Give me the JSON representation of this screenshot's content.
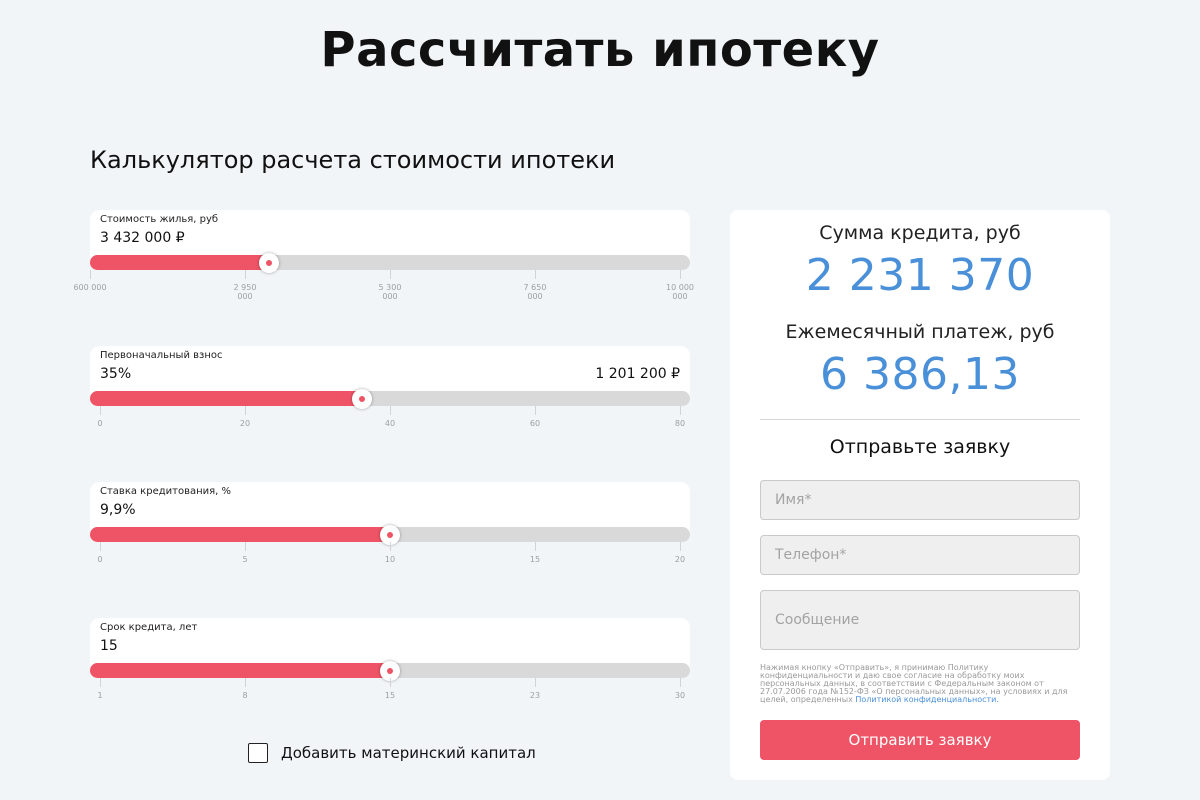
{
  "page_title": "Рассчитать ипотеку",
  "calculator_title": "Калькулятор расчета стоимости ипотеки",
  "sliders": [
    {
      "label": "Стоимость жилья, руб",
      "value": "3 432 000 ₽",
      "value_right": "",
      "level": 0.2975,
      "ticks": [
        "600 000",
        "2 950 000",
        "5 300 000",
        "7 650 000",
        "10 000 000"
      ]
    },
    {
      "label": "Первоначальный взнос",
      "value": "35%",
      "value_right": "1 201 200 ₽",
      "level": 0.4533,
      "ticks": [
        "0",
        "20",
        "40",
        "60",
        "80"
      ]
    },
    {
      "label": "Ставка кредитования, %",
      "value": "9,9%",
      "value_right": "",
      "level": 0.5,
      "ticks": [
        "0",
        "5",
        "10",
        "15",
        "20"
      ]
    },
    {
      "label": "Срок кредита, лет",
      "value": "15",
      "value_right": "",
      "level": 0.5,
      "ticks": [
        "1",
        "8",
        "15",
        "23",
        "30"
      ]
    }
  ],
  "maternal_capital": {
    "label": "Добавить материнский капитал",
    "checked": false
  },
  "result": {
    "loan_caption": "Сумма кредита, руб",
    "loan_value": "2 231 370",
    "payment_caption": "Ежемесячный платеж, руб",
    "payment_value": "6 386,13"
  },
  "form": {
    "title": "Отправьте заявку",
    "name_placeholder": "Имя*",
    "phone_placeholder": "Телефон*",
    "message_placeholder": "Сообщение",
    "consent_text": "Нажимая кнопку «Отправить», я принимаю Политику конфиденциальности и даю свое согласие на обработку моих персональных данных, в соответствии с Федеральным законом от 27.07.2006 года №152-ФЗ «О персональных данных», на условиях и для целей, определенных ",
    "consent_link": "Политикой конфиденциальности.",
    "submit_label": "Отправить заявку"
  },
  "colors": {
    "accent": "#ef5466",
    "value_blue": "#4a90d9",
    "background": "#f2f5f8"
  }
}
